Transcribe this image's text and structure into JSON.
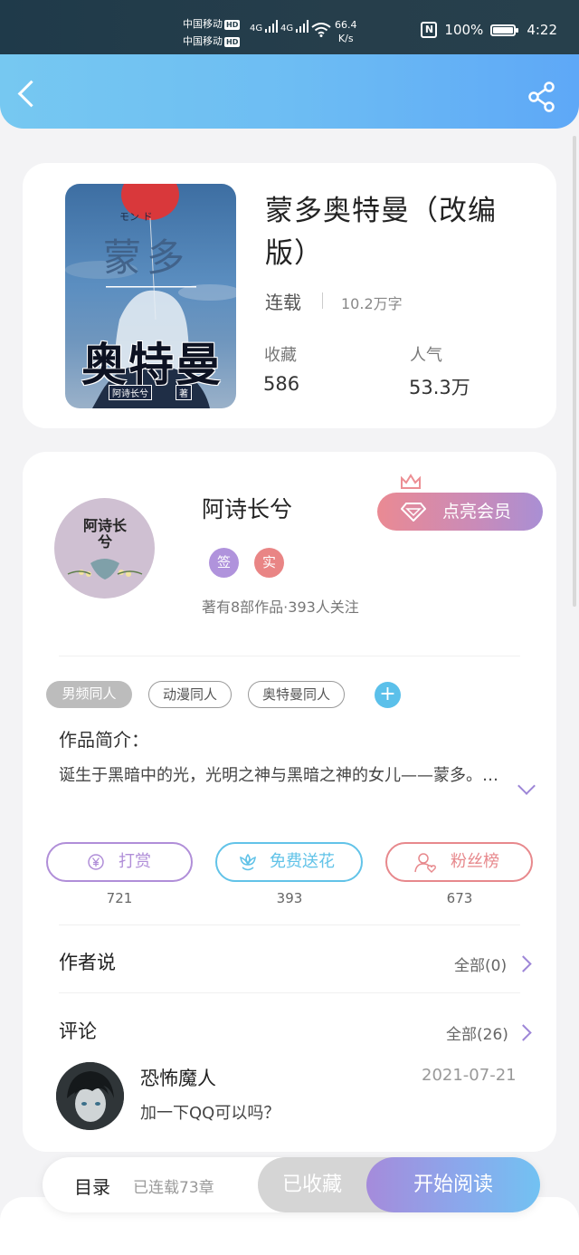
{
  "status_bar": {
    "carrier1": "中国移动",
    "carrier2": "中国移动",
    "hd": "HD",
    "net1": "4G",
    "net2": "4G",
    "speed_value": "66.4",
    "speed_unit": "K/s",
    "nfc": "N",
    "battery": "100%",
    "battery_level": 1.0,
    "time": "4:22"
  },
  "book": {
    "title": "蒙多奥特曼（改编版）",
    "status": "连载",
    "word_count": "10.2万字",
    "favorites_label": "收藏",
    "favorites_value": "586",
    "popularity_label": "人气",
    "popularity_value": "53.3万",
    "cover": {
      "kana": "モン  ド",
      "title_top": "蒙多",
      "title_bottom": "奥特曼",
      "author": "阿诗长兮",
      "by": "著"
    }
  },
  "author": {
    "name": "阿诗长兮",
    "avatar_text": "阿诗长兮",
    "badge_signed": "签",
    "badge_verified": "实",
    "meta": "著有8部作品·393人关注",
    "vip_button": "点亮会员"
  },
  "tags": [
    "男频同人",
    "动漫同人",
    "奥特曼同人"
  ],
  "tag_add": "+",
  "intro": {
    "title": "作品简介：",
    "text": "诞生于黑暗中的光，光明之神与黑暗之神的女儿——蒙多。…"
  },
  "actions": [
    {
      "label": "打赏",
      "count": "721",
      "color": "#b08ed8"
    },
    {
      "label": "免费送花",
      "count": "393",
      "color": "#62c3e8"
    },
    {
      "label": "粉丝榜",
      "count": "673",
      "color": "#e7888c"
    }
  ],
  "author_says": {
    "title": "作者说",
    "link": "全部(0)"
  },
  "comments": {
    "title": "评论",
    "link": "全部(26)",
    "items": [
      {
        "user": "恐怖魔人",
        "date": "2021-07-21",
        "text": "加一下QQ可以吗？"
      }
    ]
  },
  "bottom_bar": {
    "toc": "目录",
    "chapters": "已连载73章",
    "collected": "已收藏",
    "read": "开始阅读"
  },
  "colors": {
    "header_gradient_start": "#76c8f1",
    "header_gradient_end": "#5ea8f7",
    "accent_purple": "#9d86d7"
  }
}
